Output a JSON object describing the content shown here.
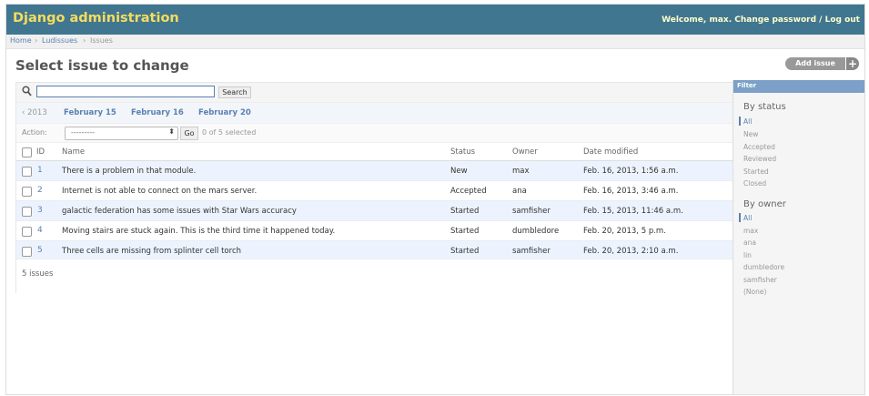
{
  "header": {
    "brand": "Django administration",
    "user_tools": "Welcome, max. Change password / Log out",
    "bg_color": "#417690",
    "brand_color": "#f5dd5d"
  },
  "breadcrumbs": {
    "home": "Home",
    "app": "Ludissues",
    "model": "Issues",
    "sep": "›"
  },
  "page": {
    "title": "Select issue to change",
    "add_label": "Add issue",
    "add_plus": "+"
  },
  "search": {
    "value": "",
    "button": "Search",
    "icon": "magnifier-icon"
  },
  "date_hierarchy": {
    "back": "‹ 2013",
    "items": [
      "February 15",
      "February 16",
      "February 20"
    ]
  },
  "actions": {
    "label": "Action:",
    "selected": "---------",
    "go": "Go",
    "count": "0 of 5 selected"
  },
  "columns": {
    "id": "ID",
    "name": "Name",
    "status": "Status",
    "owner": "Owner",
    "date": "Date modified"
  },
  "rows": [
    {
      "id": "1",
      "name": "There is a problem in that module.",
      "status": "New",
      "owner": "max",
      "date": "Feb. 16, 2013, 1:56 a.m."
    },
    {
      "id": "2",
      "name": "Internet is not able to connect on the mars server.",
      "status": "Accepted",
      "owner": "ana",
      "date": "Feb. 16, 2013, 3:46 a.m."
    },
    {
      "id": "3",
      "name": "galactic federation has some issues with Star Wars accuracy",
      "status": "Started",
      "owner": "samfisher",
      "date": "Feb. 15, 2013, 11:46 a.m."
    },
    {
      "id": "4",
      "name": "Moving stairs are stuck again. This is the third time it happened today.",
      "status": "Started",
      "owner": "dumbledore",
      "date": "Feb. 20, 2013, 5 p.m."
    },
    {
      "id": "5",
      "name": "Three cells are missing from splinter cell torch",
      "status": "Started",
      "owner": "samfisher",
      "date": "Feb. 20, 2013, 2:10 a.m."
    }
  ],
  "paginator": {
    "text": "5 issues"
  },
  "filter": {
    "title": "Filter",
    "by_status": "By status",
    "status_items": [
      "All",
      "New",
      "Accepted",
      "Reviewed",
      "Started",
      "Closed"
    ],
    "by_owner": "By owner",
    "owner_items": [
      "All",
      "max",
      "ana",
      "lin",
      "dumbledore",
      "samfisher",
      "(None)"
    ]
  }
}
